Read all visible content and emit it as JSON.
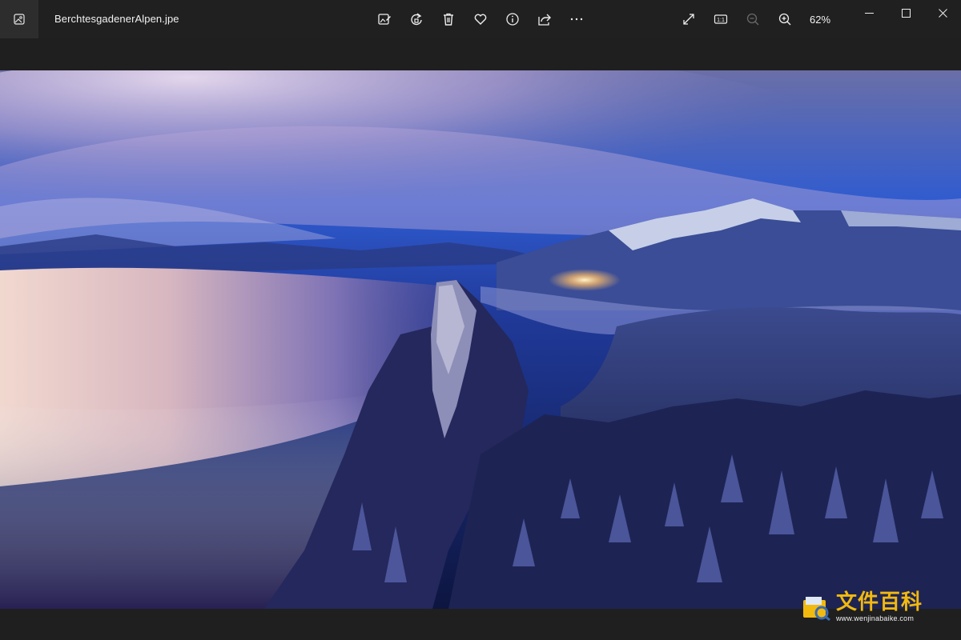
{
  "window": {
    "file_name": "BerchtesgadenerAlpen.jpe",
    "zoom": "62%"
  },
  "toolbar": {
    "items": [
      "edit-image-icon",
      "rotate-icon",
      "delete-icon",
      "favorite-icon",
      "info-icon",
      "share-icon",
      "more-icon"
    ]
  },
  "view_tools": {
    "items": [
      "fullscreen-icon",
      "actual-size-icon",
      "zoom-out-icon",
      "zoom-in-icon"
    ],
    "actual_size_label": "1:1"
  },
  "watermark": {
    "main": "文件百科",
    "sub": "www.wenjinabaike.com"
  },
  "colors": {
    "titlebar": "#202020",
    "background": "#1f1f1f",
    "watermark": "#f2b90f"
  }
}
